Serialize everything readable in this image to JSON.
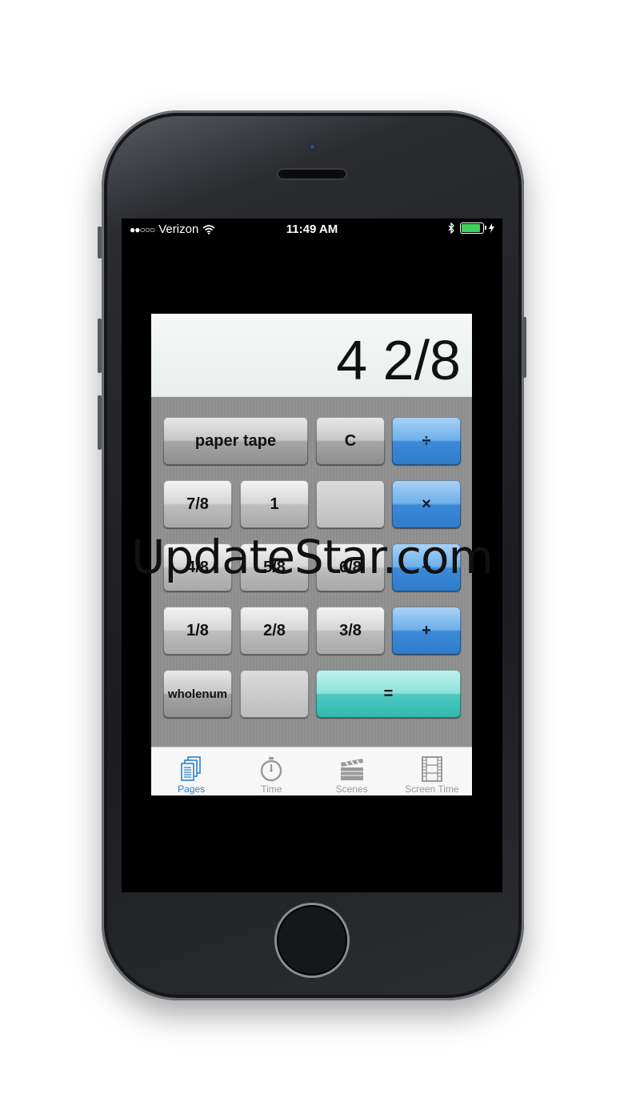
{
  "status_bar": {
    "signal": "●●○○○",
    "carrier": "Verizon",
    "time": "11:49 AM"
  },
  "display": {
    "value": "4 2/8"
  },
  "keys": {
    "paper_tape": "paper tape",
    "clear": "C",
    "divide": "÷",
    "seven_eighths": "7/8",
    "one": "1",
    "multiply": "×",
    "four_eighths": "4/8",
    "five_eighths": "5/8",
    "six_eighths": "6/8",
    "subtract": "−",
    "one_eighth": "1/8",
    "two_eighths": "2/8",
    "three_eighths": "3/8",
    "add": "+",
    "wholenum": "wholenum",
    "equals": "="
  },
  "tabs": [
    {
      "label": "Pages",
      "icon": "pages-icon",
      "active": true
    },
    {
      "label": "Time",
      "icon": "stopwatch-icon",
      "active": false
    },
    {
      "label": "Scenes",
      "icon": "clapperboard-icon",
      "active": false
    },
    {
      "label": "Screen Time",
      "icon": "film-strip-icon",
      "active": false
    }
  ],
  "colors": {
    "tab_active": "#2b83c9",
    "operator_blue": "#3b8ad8",
    "equals_teal": "#4dc9c0",
    "battery": "#3cd35a"
  },
  "watermark": "UpdateStar.com"
}
